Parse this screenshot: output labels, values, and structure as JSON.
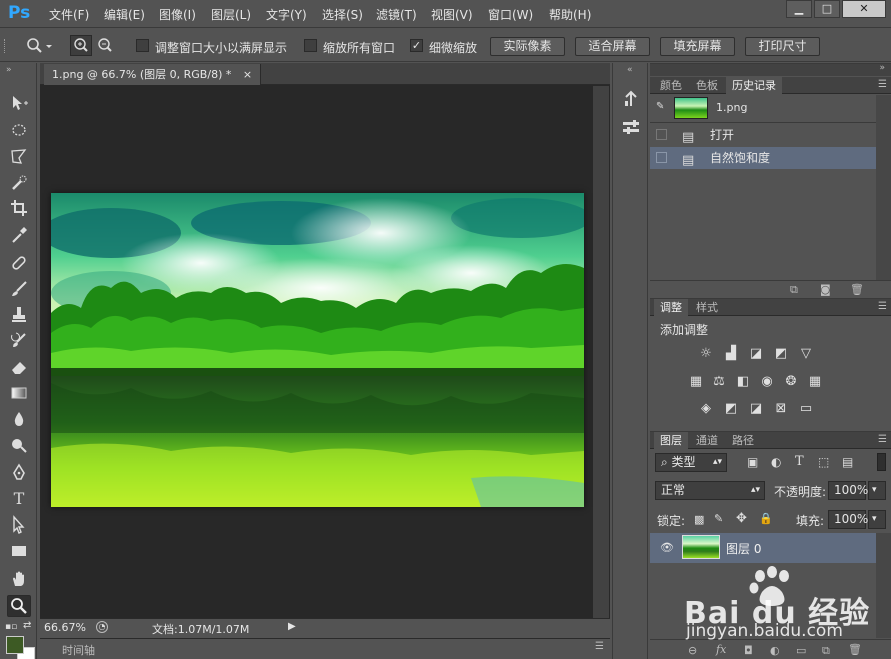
{
  "app": {
    "logo": "Ps"
  },
  "menu": [
    "文件(F)",
    "编辑(E)",
    "图像(I)",
    "图层(L)",
    "文字(Y)",
    "选择(S)",
    "滤镜(T)",
    "视图(V)",
    "窗口(W)",
    "帮助(H)"
  ],
  "window_controls": {
    "minimize": "▁",
    "maximize": "□",
    "close": "✕"
  },
  "options": {
    "resize_windows": "调整窗口大小以满屏显示",
    "zoom_all": "缩放所有窗口",
    "scrubby_zoom": "细微缩放",
    "scrubby_checked": "✓",
    "btn_actual_pixels": "实际像素",
    "btn_fit_screen": "适合屏幕",
    "btn_fill_screen": "填充屏幕",
    "btn_print_size": "打印尺寸"
  },
  "document": {
    "tab_title": "1.png @ 66.7% (图层 0, RGB/8) *",
    "tab_close": "×",
    "zoom": "66.67%",
    "doc_info": "文档:1.07M/1.07M",
    "timeline_label": "时间轴"
  },
  "panels": {
    "top_tabs": [
      "颜色",
      "色板",
      "历史记录"
    ],
    "history": {
      "snapshot_name": "1.png",
      "states": [
        "打开",
        "自然饱和度"
      ]
    },
    "adjust_tabs": [
      "调整",
      "样式"
    ],
    "adjust_title": "添加调整",
    "layers_tabs": [
      "图层",
      "通道",
      "路径"
    ],
    "layers": {
      "filter_kind": "类型",
      "blend_mode": "正常",
      "opacity_label": "不透明度:",
      "opacity_value": "100%",
      "lock_label": "锁定:",
      "fill_label": "填充:",
      "fill_value": "100%",
      "layer_name": "图层 0"
    }
  },
  "watermark": {
    "brand": "Bai du 经验",
    "url": "jingyan.baidu.com"
  },
  "colors": {
    "selection": "#5f6b7f",
    "ps_blue": "#31a8ff",
    "foreground": "#3d5a24"
  }
}
